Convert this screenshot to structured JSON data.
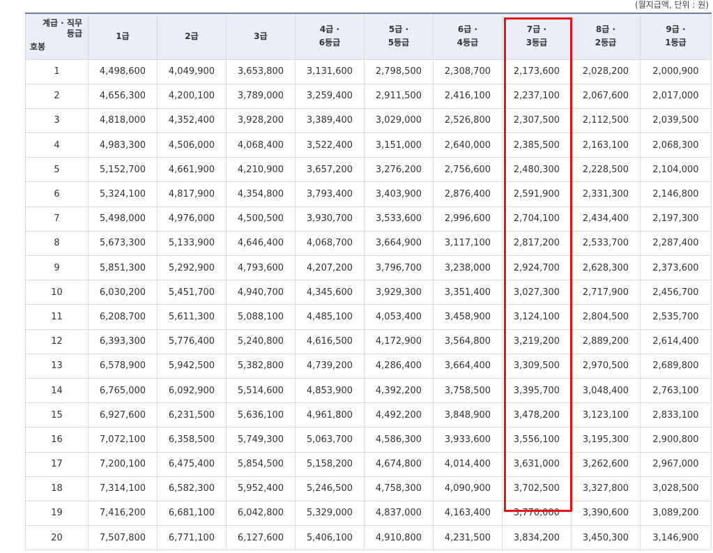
{
  "unit_note": "(월지급액, 단위 : 원)",
  "corner": {
    "line1": "계급 · 직무",
    "line2": "등급",
    "row_label": "호봉"
  },
  "grades": [
    [
      "1급"
    ],
    [
      "2급"
    ],
    [
      "3급"
    ],
    [
      "4급 ·",
      "6등급"
    ],
    [
      "5급 ·",
      "5등급"
    ],
    [
      "6급 ·",
      "4등급"
    ],
    [
      "7급 ·",
      "3등급"
    ],
    [
      "8급 ·",
      "2등급"
    ],
    [
      "9급 ·",
      "1등급"
    ]
  ],
  "highlight_color": "#e8121b",
  "header_bg": "#e9eef8",
  "rows": [
    [
      "1",
      "4,498,600",
      "4,049,900",
      "3,653,800",
      "3,131,600",
      "2,798,500",
      "2,308,700",
      "2,173,600",
      "2,028,200",
      "2,000,900"
    ],
    [
      "2",
      "4,656,300",
      "4,200,100",
      "3,789,000",
      "3,259,400",
      "2,911,500",
      "2,416,100",
      "2,237,100",
      "2,067,600",
      "2,017,000"
    ],
    [
      "3",
      "4,818,000",
      "4,352,400",
      "3,928,200",
      "3,389,400",
      "3,029,000",
      "2,526,800",
      "2,307,500",
      "2,112,500",
      "2,039,500"
    ],
    [
      "4",
      "4,983,300",
      "4,506,000",
      "4,068,400",
      "3,522,400",
      "3,151,000",
      "2,640,000",
      "2,385,500",
      "2,163,100",
      "2,068,300"
    ],
    [
      "5",
      "5,152,700",
      "4,661,900",
      "4,210,900",
      "3,657,200",
      "3,276,200",
      "2,756,600",
      "2,480,300",
      "2,228,500",
      "2,104,000"
    ],
    [
      "6",
      "5,324,100",
      "4,817,900",
      "4,354,800",
      "3,793,400",
      "3,403,900",
      "2,876,400",
      "2,591,900",
      "2,331,300",
      "2,146,800"
    ],
    [
      "7",
      "5,498,000",
      "4,976,000",
      "4,500,500",
      "3,930,700",
      "3,533,600",
      "2,996,600",
      "2,704,100",
      "2,434,400",
      "2,197,300"
    ],
    [
      "8",
      "5,673,300",
      "5,133,900",
      "4,646,400",
      "4,068,700",
      "3,664,900",
      "3,117,100",
      "2,817,200",
      "2,533,700",
      "2,287,400"
    ],
    [
      "9",
      "5,851,300",
      "5,292,900",
      "4,793,600",
      "4,207,200",
      "3,796,700",
      "3,238,000",
      "2,924,700",
      "2,628,300",
      "2,373,600"
    ],
    [
      "10",
      "6,030,200",
      "5,451,700",
      "4,940,700",
      "4,345,600",
      "3,929,300",
      "3,351,400",
      "3,027,300",
      "2,717,900",
      "2,456,700"
    ],
    [
      "11",
      "6,208,700",
      "5,611,300",
      "5,088,100",
      "4,485,100",
      "4,053,400",
      "3,458,900",
      "3,124,100",
      "2,804,500",
      "2,535,700"
    ],
    [
      "12",
      "6,393,300",
      "5,776,400",
      "5,240,800",
      "4,616,500",
      "4,172,900",
      "3,564,800",
      "3,219,200",
      "2,889,200",
      "2,614,400"
    ],
    [
      "13",
      "6,578,900",
      "5,942,500",
      "5,382,800",
      "4,739,200",
      "4,286,400",
      "3,664,400",
      "3,309,500",
      "2,970,500",
      "2,689,800"
    ],
    [
      "14",
      "6,765,000",
      "6,092,900",
      "5,514,600",
      "4,853,900",
      "4,392,200",
      "3,758,500",
      "3,395,700",
      "3,048,400",
      "2,763,100"
    ],
    [
      "15",
      "6,927,600",
      "6,231,500",
      "5,636,100",
      "4,961,800",
      "4,492,200",
      "3,848,900",
      "3,478,200",
      "3,123,100",
      "2,833,100"
    ],
    [
      "16",
      "7,072,100",
      "6,358,500",
      "5,749,300",
      "5,063,700",
      "4,586,300",
      "3,933,600",
      "3,556,100",
      "3,195,300",
      "2,900,800"
    ],
    [
      "17",
      "7,200,100",
      "6,475,400",
      "5,854,500",
      "5,158,200",
      "4,674,800",
      "4,014,400",
      "3,631,000",
      "3,262,600",
      "2,967,000"
    ],
    [
      "18",
      "7,314,100",
      "6,582,300",
      "5,952,400",
      "5,246,500",
      "4,758,300",
      "4,090,900",
      "3,702,500",
      "3,327,800",
      "3,028,500"
    ],
    [
      "19",
      "7,416,200",
      "6,681,100",
      "6,042,800",
      "5,329,000",
      "4,837,000",
      "4,163,400",
      "3,770,000",
      "3,390,600",
      "3,089,200"
    ],
    [
      "20",
      "7,507,800",
      "6,771,100",
      "6,127,600",
      "5,406,100",
      "4,910,800",
      "4,231,500",
      "3,834,200",
      "3,450,300",
      "3,146,900"
    ]
  ]
}
